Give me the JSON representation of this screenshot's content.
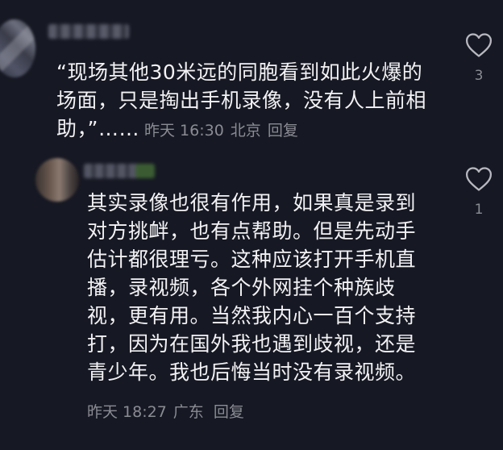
{
  "comments": [
    {
      "text": "“现场其他30米远的同胞看到如此火爆的场面，只是掏出手机录像，没有人上前相助，”",
      "ellipsis": "……",
      "time": "昨天 16:30",
      "location": "北京",
      "reply_label": "回复",
      "likes": "3"
    },
    {
      "text": "其实录像也很有作用，如果真是录到对方挑衅，也有点帮助。但是先动手估计都很理亏。这种应该打开手机直播，录视频，各个外网挂个种族歧视，更有用。当然我内心一百个支持打，因为在国外我也遇到歧视，还是青少年。我也后悔当时没有录视频。",
      "time": "昨天 18:27",
      "location": "广东",
      "reply_label": "回复",
      "likes": "1"
    }
  ],
  "colors": {
    "background": "#161823",
    "text": "#f2f2f4",
    "meta": "#8a8b93"
  },
  "icons": {
    "like": "heart-outline-icon"
  }
}
